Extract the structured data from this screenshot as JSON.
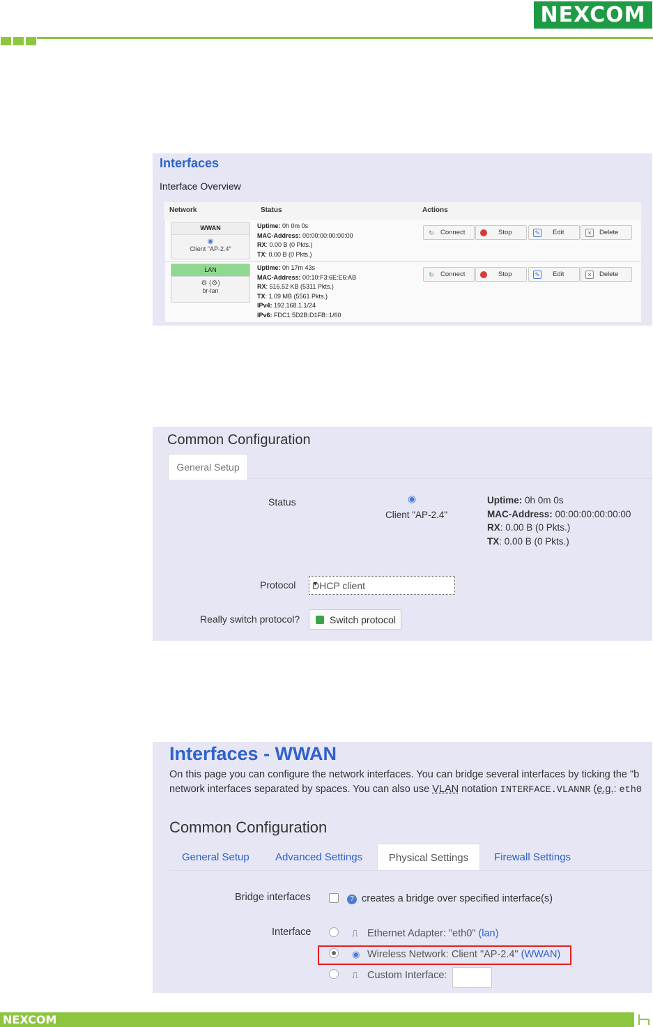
{
  "brand": {
    "logo": "NEXCOM"
  },
  "overview": {
    "title": "Interfaces",
    "subtitle": "Interface Overview",
    "columns": [
      "Network",
      "Status",
      "Actions"
    ],
    "rows": [
      {
        "name": "WWAN",
        "device": "Client \"AP-2.4\"",
        "status": [
          {
            "k": "Uptime:",
            "v": " 0h 0m 0s"
          },
          {
            "k": "MAC-Address:",
            "v": " 00:00:00:00:00:00"
          },
          {
            "k": "RX",
            "v": ": 0.00 B (0 Pkts.)"
          },
          {
            "k": "TX",
            "v": ": 0.00 B (0 Pkts.)"
          }
        ]
      },
      {
        "name": "LAN",
        "device": "br-lan",
        "status": [
          {
            "k": "Uptime:",
            "v": " 0h 17m 43s"
          },
          {
            "k": "MAC-Address:",
            "v": " 00:10:F3:6E:E6:AB"
          },
          {
            "k": "RX",
            "v": ": 516.52 KB (5311 Pkts.)"
          },
          {
            "k": "TX",
            "v": ": 1.09 MB (5561 Pkts.)"
          },
          {
            "k": "IPv4:",
            "v": " 192.168.1.1/24"
          },
          {
            "k": "IPv6:",
            "v": " FDC1:5D2B:D1FB::1/60"
          }
        ]
      }
    ],
    "actions": [
      "Connect",
      "Stop",
      "Edit",
      "Delete"
    ]
  },
  "common": {
    "title": "Common Configuration",
    "tab": "General Setup",
    "status_label": "Status",
    "device": "Client \"AP-2.4\"",
    "status": [
      {
        "k": "Uptime:",
        "v": " 0h 0m 0s"
      },
      {
        "k": "MAC-Address:",
        "v": " 00:00:00:00:00:00"
      },
      {
        "k": "RX",
        "v": ": 0.00 B (0 Pkts.)"
      },
      {
        "k": "TX",
        "v": ": 0.00 B (0 Pkts.)"
      }
    ],
    "protocol_label": "Protocol",
    "protocol_value": "DHCP client",
    "switch_label": "Really switch protocol?",
    "switch_button": "Switch protocol"
  },
  "wwan": {
    "title": "Interfaces - WWAN",
    "desc1": "On this page you can configure the network interfaces. You can bridge several interfaces by ticking the \"b",
    "desc2a": "network interfaces separated by spaces. You can also use ",
    "desc2b": "VLAN",
    "desc2c": " notation ",
    "desc2d": "INTERFACE.VLANNR",
    "desc2e": " (",
    "desc2f": "e.g.",
    "desc2g": ": ",
    "desc2h": "eth0",
    "section": "Common Configuration",
    "tabs": [
      "General Setup",
      "Advanced Settings",
      "Physical Settings",
      "Firewall Settings"
    ],
    "bridge_label": "Bridge interfaces",
    "bridge_hint": "creates a bridge over specified interface(s)",
    "interface_label": "Interface",
    "options": [
      {
        "text": "Ethernet Adapter: \"eth0\" ",
        "link": "(lan)"
      },
      {
        "text": "Wireless Network: Client \"AP-2.4\" ",
        "link": "(WWAN)"
      },
      {
        "text": "Custom Interface:",
        "link": ""
      }
    ]
  }
}
